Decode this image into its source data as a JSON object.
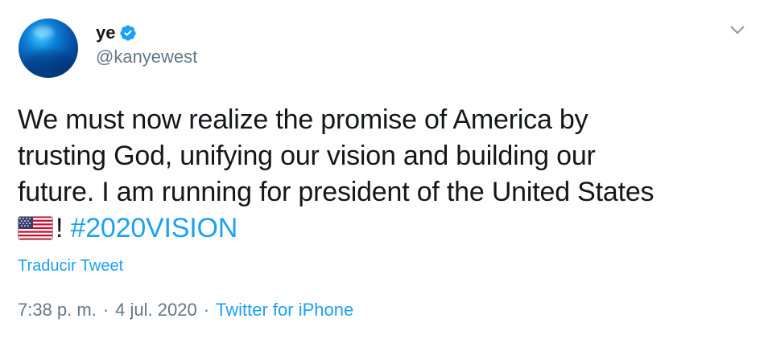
{
  "author": {
    "display_name": "ye",
    "handle": "@kanyewest",
    "verified_icon": "verified-badge-icon",
    "avatar": "blue-sphere-avatar"
  },
  "tweet": {
    "text_line1": "We must now realize the promise of America by",
    "text_line2": "trusting God, unifying our vision and building our",
    "text_line3": "future. I am running for president of the United States",
    "flag_emoji": "us-flag-icon",
    "exclamation": "!",
    "hashtag": "#2020VISION"
  },
  "translate_label": "Traducir Tweet",
  "meta": {
    "time": "7:38 p. m.",
    "separator": "·",
    "date": "4 jul. 2020",
    "source": "Twitter for iPhone"
  },
  "colors": {
    "accent": "#1da1f2",
    "text": "#14171a",
    "secondary": "#657786"
  }
}
